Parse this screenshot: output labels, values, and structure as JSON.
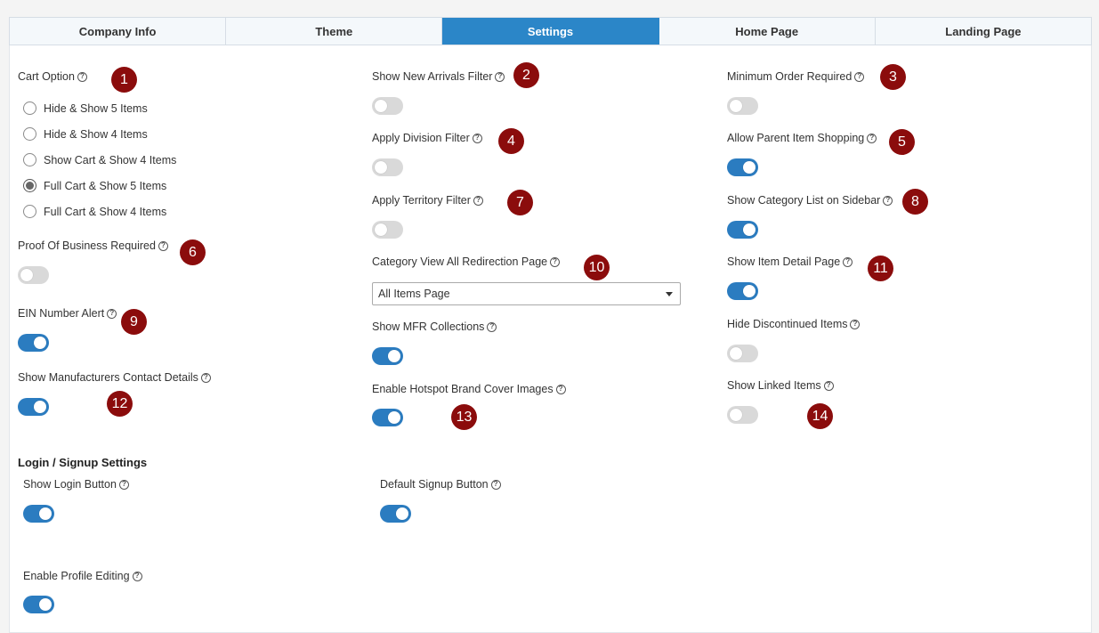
{
  "tabs": [
    {
      "label": "Company Info"
    },
    {
      "label": "Theme"
    },
    {
      "label": "Settings"
    },
    {
      "label": "Home Page"
    },
    {
      "label": "Landing Page"
    }
  ],
  "help_glyph": "?",
  "cart_option": {
    "label": "Cart Option",
    "options": [
      {
        "label": "Hide & Show 5 Items",
        "selected": false
      },
      {
        "label": "Hide & Show 4 Items",
        "selected": false
      },
      {
        "label": "Show Cart & Show 4 Items",
        "selected": false
      },
      {
        "label": "Full Cart & Show 5 Items",
        "selected": true
      },
      {
        "label": "Full Cart & Show 4 Items",
        "selected": false
      }
    ]
  },
  "settings": {
    "proof_of_business": {
      "label": "Proof Of Business Required",
      "on": false
    },
    "ein_number_alert": {
      "label": "EIN Number Alert",
      "on": true
    },
    "show_manufacturers_contact": {
      "label": "Show Manufacturers Contact Details",
      "on": true
    },
    "show_new_arrivals": {
      "label": "Show New Arrivals Filter",
      "on": false
    },
    "apply_division_filter": {
      "label": "Apply Division Filter",
      "on": false
    },
    "apply_territory_filter": {
      "label": "Apply Territory Filter",
      "on": false
    },
    "category_view_all_redirection": {
      "label": "Category View All Redirection Page",
      "value": "All Items Page"
    },
    "show_mfr_collections": {
      "label": "Show MFR Collections",
      "on": true
    },
    "enable_hotspot_brand_cover": {
      "label": "Enable Hotspot Brand Cover Images",
      "on": true
    },
    "minimum_order_required": {
      "label": "Minimum Order Required",
      "on": false
    },
    "allow_parent_item_shopping": {
      "label": "Allow Parent Item Shopping",
      "on": true
    },
    "show_category_list_sidebar": {
      "label": "Show Category List on Sidebar",
      "on": true
    },
    "show_item_detail_page": {
      "label": "Show Item Detail Page",
      "on": true
    },
    "hide_discontinued_items": {
      "label": "Hide Discontinued Items",
      "on": false
    },
    "show_linked_items": {
      "label": "Show Linked Items",
      "on": false
    }
  },
  "login_signup": {
    "title": "Login / Signup Settings",
    "show_login_button": {
      "label": "Show Login Button",
      "on": true
    },
    "default_signup_button": {
      "label": "Default Signup Button",
      "on": true
    },
    "enable_profile_editing": {
      "label": "Enable Profile Editing",
      "on": true
    }
  },
  "badges": [
    "1",
    "2",
    "3",
    "4",
    "5",
    "6",
    "7",
    "8",
    "9",
    "10",
    "11",
    "12",
    "13",
    "14"
  ],
  "colors": {
    "accent": "#2b86c8",
    "toggle_on": "#2b7cc0",
    "badge": "#8b0c0c"
  }
}
